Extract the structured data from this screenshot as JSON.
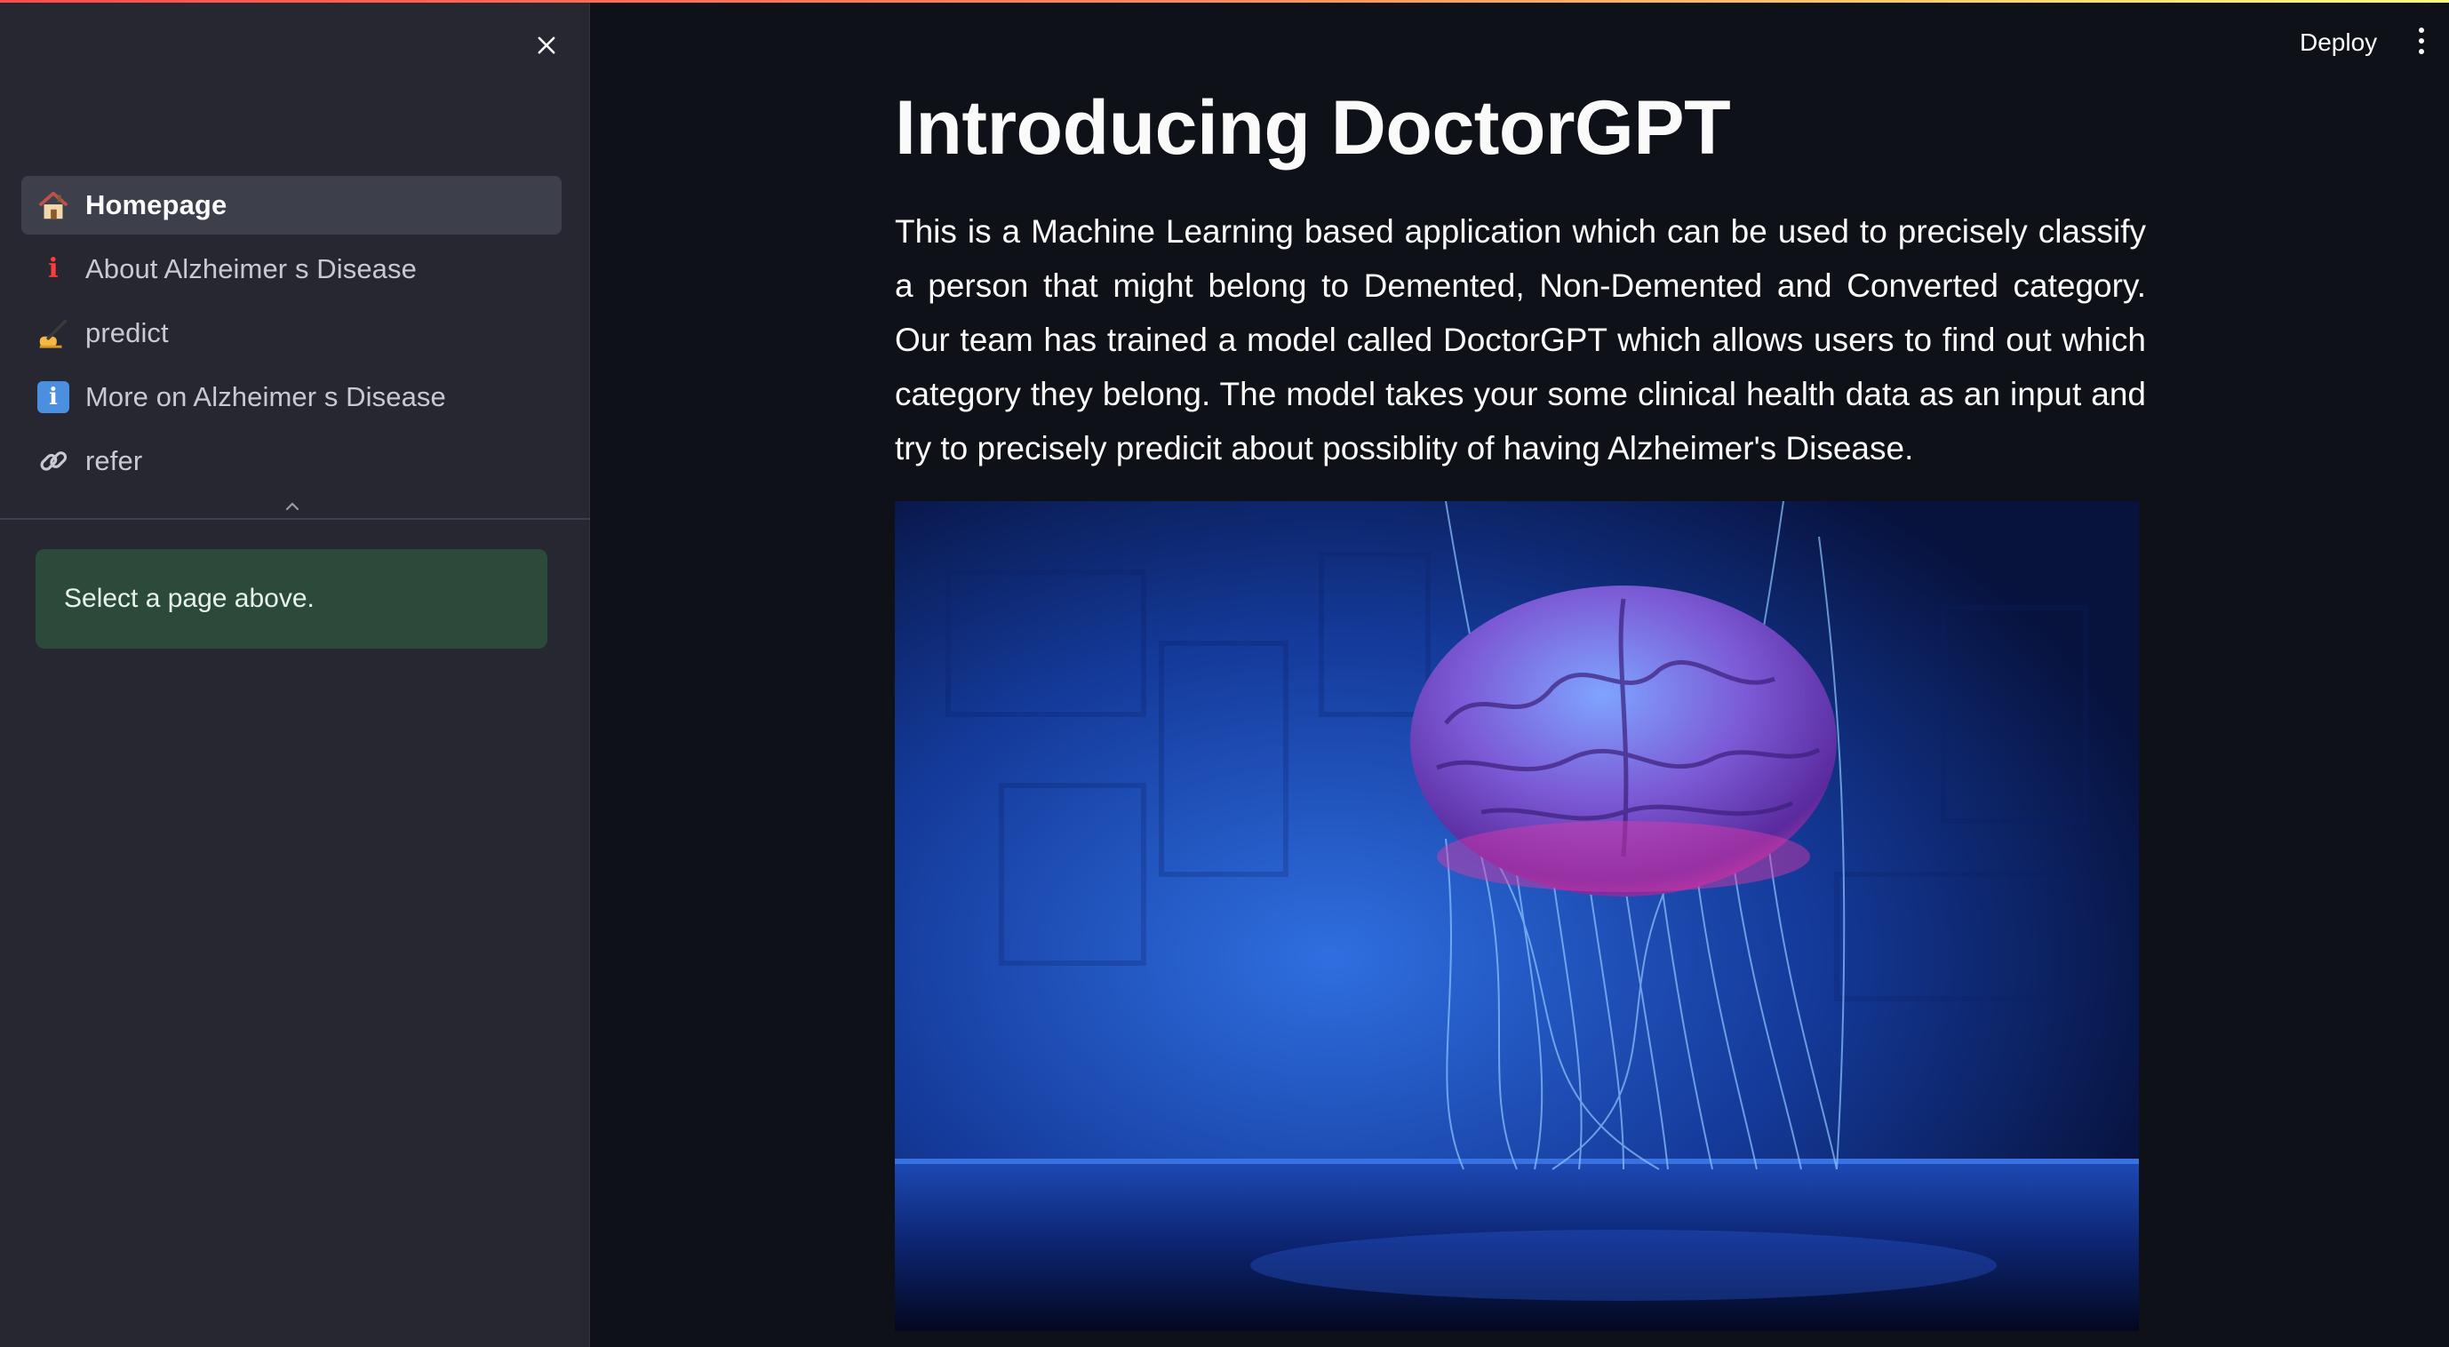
{
  "sidebar": {
    "nav_items": [
      {
        "icon": "house-icon",
        "label": "Homepage",
        "active": true
      },
      {
        "icon": "information-red-icon",
        "label": "About Alzheimer s Disease",
        "active": false
      },
      {
        "icon": "writing-hand-icon",
        "label": "predict",
        "active": false
      },
      {
        "icon": "information-box-icon",
        "label": "More on Alzheimer s Disease",
        "active": false
      },
      {
        "icon": "link-icon",
        "label": "refer",
        "active": false
      }
    ],
    "info_message": "Select a page above."
  },
  "header": {
    "deploy_label": "Deploy"
  },
  "main": {
    "title": "Introducing DoctorGPT",
    "description": "This is a Machine Learning based application which can be used to precisely classify a person that might belong to Demented, Non-Demented and Converted category. Our team has trained a model called DoctorGPT which allows users to find out which category they belong. The model takes your some clinical health data as an input and try to precisely predicit about possiblity of having Alzheimer's Disease."
  },
  "colors": {
    "accent_gradient_start": "#ff4b4b",
    "sidebar_bg": "#262730",
    "main_bg": "#0e1117",
    "active_item_bg": "#3d3f4b",
    "info_box_bg": "#2c4a3a"
  }
}
